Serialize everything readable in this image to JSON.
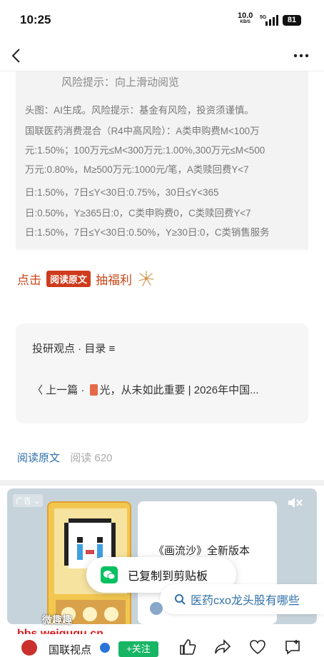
{
  "status": {
    "time": "10:25",
    "net_speed": "10.0",
    "net_unit": "KB/S",
    "network": "5G",
    "battery": "81"
  },
  "article": {
    "risk_scroll_hint": "风险提示：向上滑动阅览",
    "disclosure_lines": [
      "头图：AI生成。风险提示：基金有风险，投资须谨慎。",
      "国联医药消费混合（R4中高风险）：A类申购费M<100万",
      "元:1.50%；100万元≤M<300万元:1.00%,300万元≤M<500",
      "万元:0.80%，M≥500万元:1000元/笔，A类赎回费Y<7",
      "日:1.50%，7日≤Y<30日:0.75%，30日≤Y<365",
      "日:0.50%，Y≥365日:0，C类申购费0，C类赎回费Y<7",
      "日:1.50%，7日≤Y<30日:0.50%，Y≥30日:0，C类销售服务"
    ],
    "benefit_prefix": "点击",
    "benefit_badge": "阅读原文",
    "benefit_suffix": "抽福利",
    "toc_label": "投研观点 · 目录 ≡",
    "prev_label": "〈 上一篇 · ",
    "prev_title": "光，从未如此重要 | 2026年中国...",
    "read_original": "阅读原文",
    "read_count": "阅读 620"
  },
  "ad": {
    "tag": "广告",
    "title": "《画流沙》全新版本"
  },
  "toast": {
    "message": "已复制到剪贴板"
  },
  "search_suggestion": "医药cxo龙头股有哪些",
  "watermark": {
    "top": "微趣趣",
    "bottom": "bbs.weiququ.cn"
  },
  "bottom_bar": {
    "account": "国联视点",
    "follow": "+关注"
  },
  "colors": {
    "accent_red": "#cf3b1d",
    "link_blue": "#2f6fa9",
    "follow_green": "#18b565",
    "wechat_green": "#07c160"
  }
}
